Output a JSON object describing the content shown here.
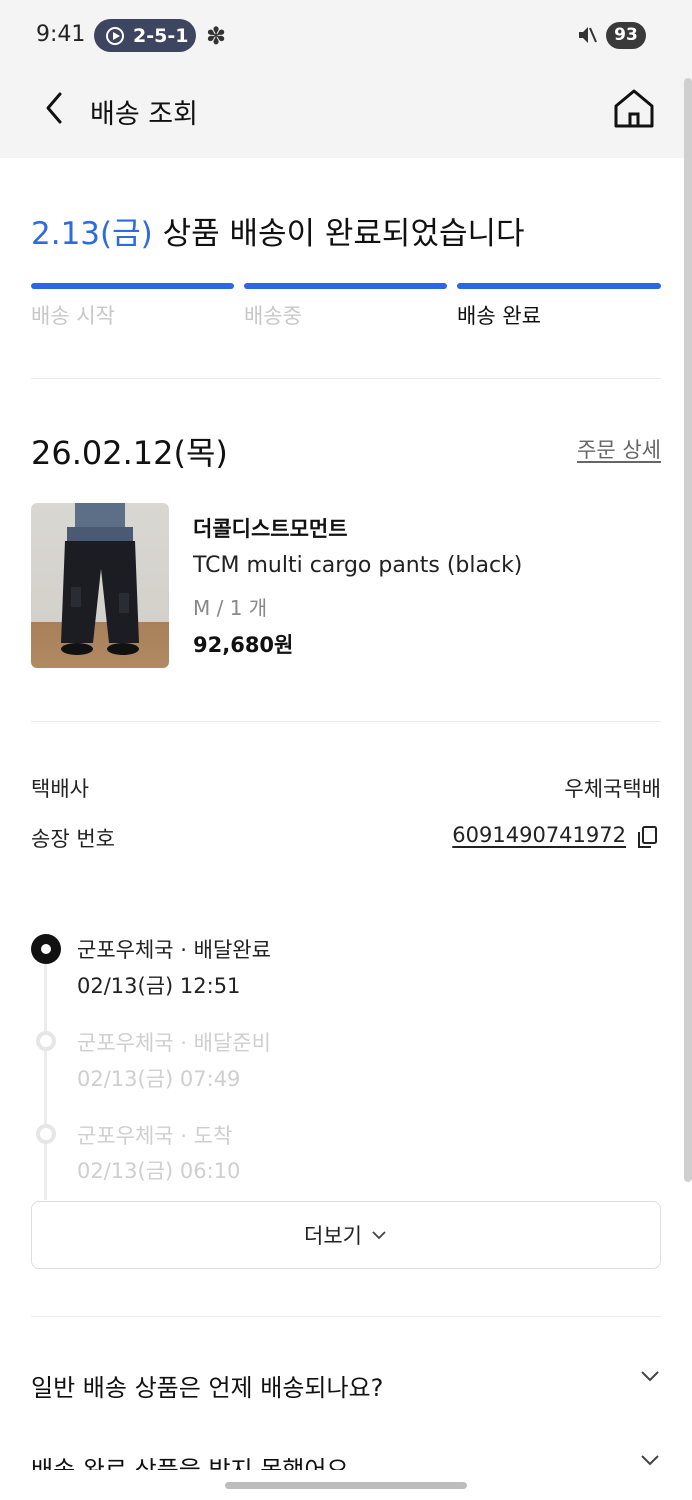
{
  "status_bar": {
    "time": "9:41",
    "pill_label": "2-5-1",
    "battery": "93"
  },
  "header": {
    "title": "배송 조회"
  },
  "delivery": {
    "date_highlight": "2.13(금)",
    "message": " 상품 배송이 완료되었습니다",
    "steps": [
      "배송 시작",
      "배송중",
      "배송 완료"
    ],
    "current_step": 3
  },
  "order": {
    "date": "26.02.12(목)",
    "detail_link": "주문 상세",
    "product": {
      "brand": "더콜디스트모먼트",
      "name": "TCM multi cargo pants (black)",
      "option": "M / 1 개",
      "price": "92,680원"
    }
  },
  "shipping": {
    "courier_label": "택배사",
    "courier_value": "우체국택배",
    "tracking_label": "송장 번호",
    "tracking_value": "6091490741972"
  },
  "timeline": [
    {
      "title": "군포우체국 · 배달완료",
      "time": "02/13(금) 12:51"
    },
    {
      "title": "군포우체국 · 배달준비",
      "time": "02/13(금) 07:49"
    },
    {
      "title": "군포우체국 · 도착",
      "time": "02/13(금) 06:10"
    }
  ],
  "more_button": "더보기",
  "faq": [
    "일반 배송 상품은 언제 배송되나요?",
    "배송 완료 상품을 받지 못했어요"
  ],
  "icons": {
    "back": "chevron-left-icon",
    "home": "home-icon",
    "copy": "copy-icon",
    "expand": "chevron-down-icon"
  },
  "colors": {
    "accent": "#2a67e8",
    "headline_date": "#2c6be0"
  }
}
